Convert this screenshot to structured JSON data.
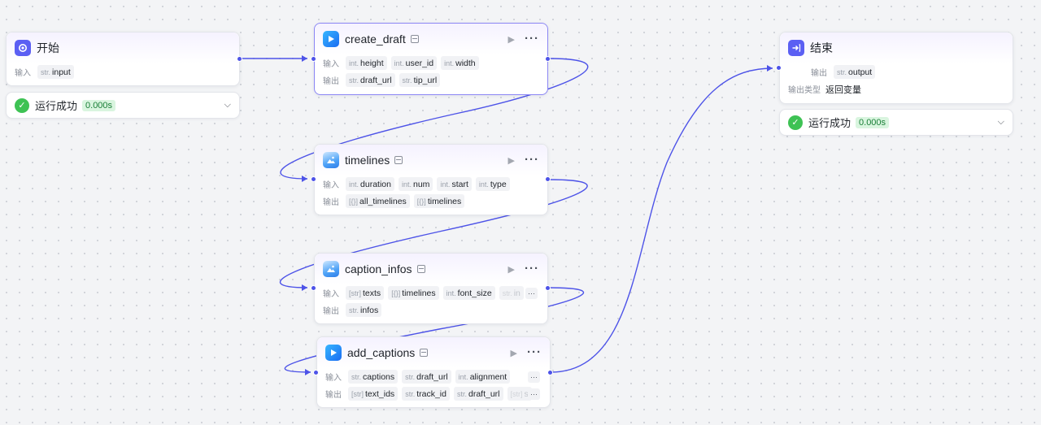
{
  "colors": {
    "accent": "#4d53e8",
    "wire": "#4d53e8",
    "success": "#3ec254",
    "success_badge_bg": "#d9f5df",
    "success_badge_text": "#1a7f37",
    "selected_border": "#8b86f5"
  },
  "labels": {
    "input": "输入",
    "output": "输出",
    "output_type": "输出类型"
  },
  "start_node": {
    "title": "开始",
    "icon": "start-icon",
    "inputs": [
      {
        "type": "str.",
        "name": "input"
      }
    ]
  },
  "start_status": {
    "text": "运行成功",
    "time": "0.000s"
  },
  "create_draft": {
    "title": "create_draft",
    "icon": "jianying-play-icon",
    "inputs": [
      {
        "type": "int.",
        "name": "height"
      },
      {
        "type": "int.",
        "name": "user_id"
      },
      {
        "type": "int.",
        "name": "width"
      }
    ],
    "outputs": [
      {
        "type": "str.",
        "name": "draft_url"
      },
      {
        "type": "str.",
        "name": "tip_url"
      }
    ]
  },
  "timelines": {
    "title": "timelines",
    "icon": "plugin-image-icon",
    "inputs": [
      {
        "type": "int.",
        "name": "duration"
      },
      {
        "type": "int.",
        "name": "num"
      },
      {
        "type": "int.",
        "name": "start"
      },
      {
        "type": "int.",
        "name": "type"
      }
    ],
    "outputs": [
      {
        "type": "[{}]",
        "name": "all_timelines"
      },
      {
        "type": "[{}]",
        "name": "timelines"
      }
    ]
  },
  "caption_infos": {
    "title": "caption_infos",
    "icon": "plugin-image-icon",
    "inputs": [
      {
        "type": "[str]",
        "name": "texts"
      },
      {
        "type": "[{}]",
        "name": "timelines"
      },
      {
        "type": "int.",
        "name": "font_size"
      },
      {
        "type": "str.",
        "name": "in"
      }
    ],
    "outputs": [
      {
        "type": "str.",
        "name": "infos"
      }
    ]
  },
  "add_captions": {
    "title": "add_captions",
    "icon": "jianying-play-icon",
    "inputs": [
      {
        "type": "str.",
        "name": "captions"
      },
      {
        "type": "str.",
        "name": "draft_url"
      },
      {
        "type": "int.",
        "name": "alignment"
      }
    ],
    "outputs": [
      {
        "type": "[str]",
        "name": "text_ids"
      },
      {
        "type": "str.",
        "name": "track_id"
      },
      {
        "type": "str.",
        "name": "draft_url"
      },
      {
        "type": "[str]",
        "name": "s"
      }
    ]
  },
  "end_node": {
    "title": "结束",
    "icon": "end-icon",
    "outputs": [
      {
        "type": "str.",
        "name": "output"
      }
    ],
    "output_type_value": "返回变量"
  },
  "end_status": {
    "text": "运行成功",
    "time": "0.000s"
  }
}
